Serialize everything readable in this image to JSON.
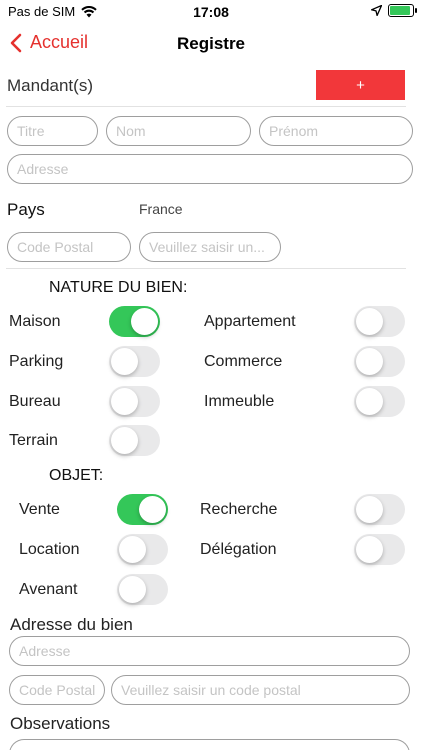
{
  "status_bar": {
    "carrier": "Pas de SIM",
    "time": "17:08"
  },
  "nav": {
    "back_label": "Accueil",
    "title": "Registre"
  },
  "mandants": {
    "label": "Mandant(s)",
    "add_label": "+",
    "titre_placeholder": "Titre",
    "nom_placeholder": "Nom",
    "prenom_placeholder": "Prénom",
    "adresse_placeholder": "Adresse",
    "pays_label": "Pays",
    "pays_value": "France",
    "code_postal_placeholder": "Code Postal",
    "ville_placeholder": "Veuillez saisir un..."
  },
  "nature": {
    "title": "NATURE DU BIEN:",
    "options": [
      {
        "label": "Maison",
        "on": true
      },
      {
        "label": "Appartement",
        "on": false
      },
      {
        "label": "Parking",
        "on": false
      },
      {
        "label": "Commerce",
        "on": false
      },
      {
        "label": "Bureau",
        "on": false
      },
      {
        "label": "Immeuble",
        "on": false
      },
      {
        "label": "Terrain",
        "on": false
      }
    ]
  },
  "objet": {
    "title": "OBJET:",
    "options": [
      {
        "label": "Vente",
        "on": true
      },
      {
        "label": "Recherche",
        "on": false
      },
      {
        "label": "Location",
        "on": false
      },
      {
        "label": "Délégation",
        "on": false
      },
      {
        "label": "Avenant",
        "on": false
      }
    ]
  },
  "bien": {
    "label": "Adresse du bien",
    "adresse_placeholder": "Adresse",
    "code_postal_placeholder": "Code Postal",
    "ville_placeholder": "Veuillez saisir un code postal"
  },
  "observations": {
    "label": "Observations"
  },
  "colors": {
    "accent": "#e5312e",
    "add_button": "#f2373a",
    "toggle_on": "#34c759",
    "toggle_off": "#e9e9ea"
  }
}
